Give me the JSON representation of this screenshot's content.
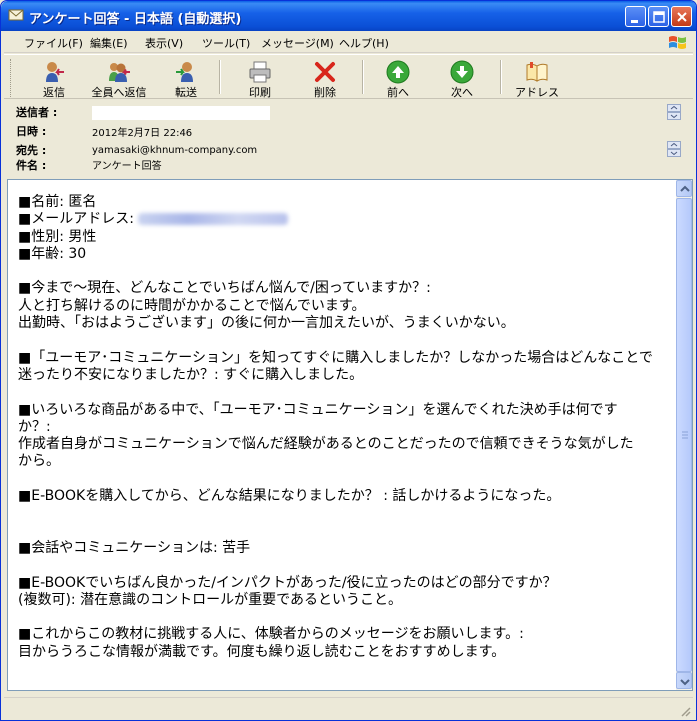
{
  "window": {
    "title": "アンケート回答 - 日本語 (自動選択)"
  },
  "menu": [
    "ファイル(F)",
    "編集(E)",
    "表示(V)",
    "ツール(T)",
    "メッセージ(M)",
    "ヘルプ(H)"
  ],
  "toolbar": {
    "reply": "返信",
    "reply_all": "全員へ返信",
    "forward": "転送",
    "print": "印刷",
    "delete": "削除",
    "previous": "前へ",
    "next": "次へ",
    "address": "アドレス"
  },
  "header": {
    "from_label": "送信者 :",
    "date_label": "日時 :",
    "date_value": "2012年2月7日 22:46",
    "to_label": "宛先 :",
    "to_value": "yamasaki@khnum-company.com",
    "subject_label": "件名 :",
    "subject_value": "アンケート回答"
  },
  "body": {
    "l1": "■名前: 匿名",
    "l2": "■メールアドレス: ",
    "l3": "■性別: 男性",
    "l4": "■年齢: 30",
    "l5": "",
    "l6": "■今まで～現在、どんなことでいちばん悩んで/困っていますか？:",
    "l7": "人と打ち解けるのに時間がかかることで悩んでいます。",
    "l8": "出勤時、「おはようございます」の後に何か一言加えたいが、うまくいかない。",
    "l9": "",
    "l10": "■「ユーモア･コミュニケーション」を知ってすぐに購入しましたか？しなかった場合はどんなことで",
    "l11": "迷ったり不安になりましたか？: すぐに購入しました。",
    "l12": "",
    "l13": "■いろいろな商品がある中で、「ユーモア･コミュニケーション」を選んでくれた決め手は何です",
    "l14": "か？:",
    "l15": "作成者自身がコミュニケーションで悩んだ経験があるとのことだったので信頼できそうな気がした",
    "l16": "から。",
    "l17": "",
    "l18": "■E-BOOKを購入してから、どんな結果になりましたか？ : 話しかけるようになった。",
    "l19": "",
    "l20": "",
    "l21": "■会話やコミュニケーションは: 苦手",
    "l22": "",
    "l23": "■E-BOOKでいちばん良かった/インパクトがあった/役に立ったのはどの部分ですか？",
    "l24": "(複数可): 潜在意識のコントロールが重要であるということ。",
    "l25": "",
    "l26": "■これからこの教材に挑戦する人に、体験者からのメッセージをお願いします。:",
    "l27": "目からうろこな情報が満載です。何度も繰り返し読むことをおすすめします。"
  },
  "icons": {
    "app": "mail-icon",
    "reply": "reply-icon",
    "reply_all": "reply-all-icon",
    "forward": "forward-icon",
    "print": "printer-icon",
    "delete": "red-x-icon",
    "previous": "green-up-arrow-icon",
    "next": "green-down-arrow-icon",
    "address": "address-book-icon"
  }
}
